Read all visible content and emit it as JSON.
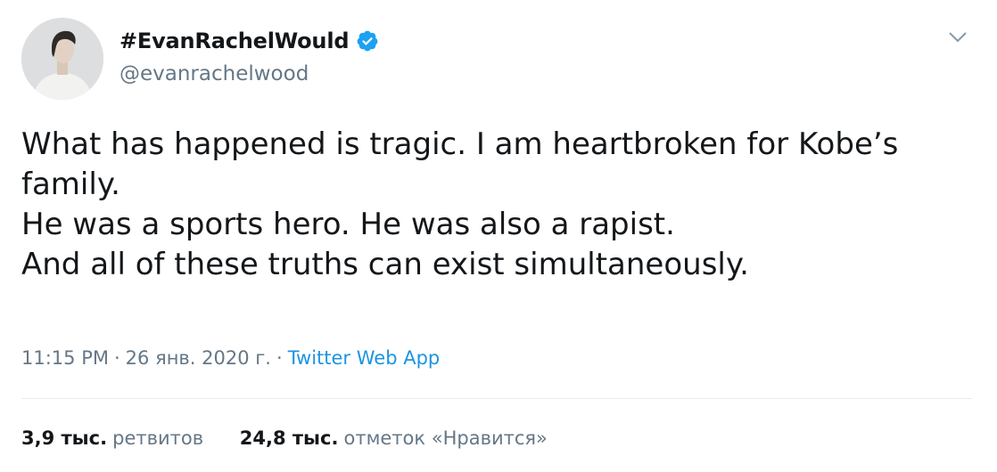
{
  "author": {
    "display_name": "#EvanRachelWould",
    "handle": "@evanrachelwood",
    "verified_icon": "verified-badge-icon",
    "avatar_icon": "avatar"
  },
  "tweet": {
    "lines": [
      "What has happened is tragic. I am heartbroken for Kobe’s family.",
      "He was a sports hero. He was also a rapist.",
      "And all of these truths can exist simultaneously."
    ]
  },
  "meta": {
    "time": "11:15 PM",
    "separator1": "·",
    "date": "26 янв. 2020 г.",
    "separator2": "·",
    "source": "Twitter Web App"
  },
  "stats": {
    "retweets_count": "3,9 тыс.",
    "retweets_label": "ретвитов",
    "likes_count": "24,8 тыс.",
    "likes_label": "отметок «Нравится»"
  },
  "colors": {
    "text": "#14171a",
    "secondary": "#657786",
    "link": "#1b95e0",
    "verified": "#1da1f2",
    "divider": "#e6ecf0"
  }
}
